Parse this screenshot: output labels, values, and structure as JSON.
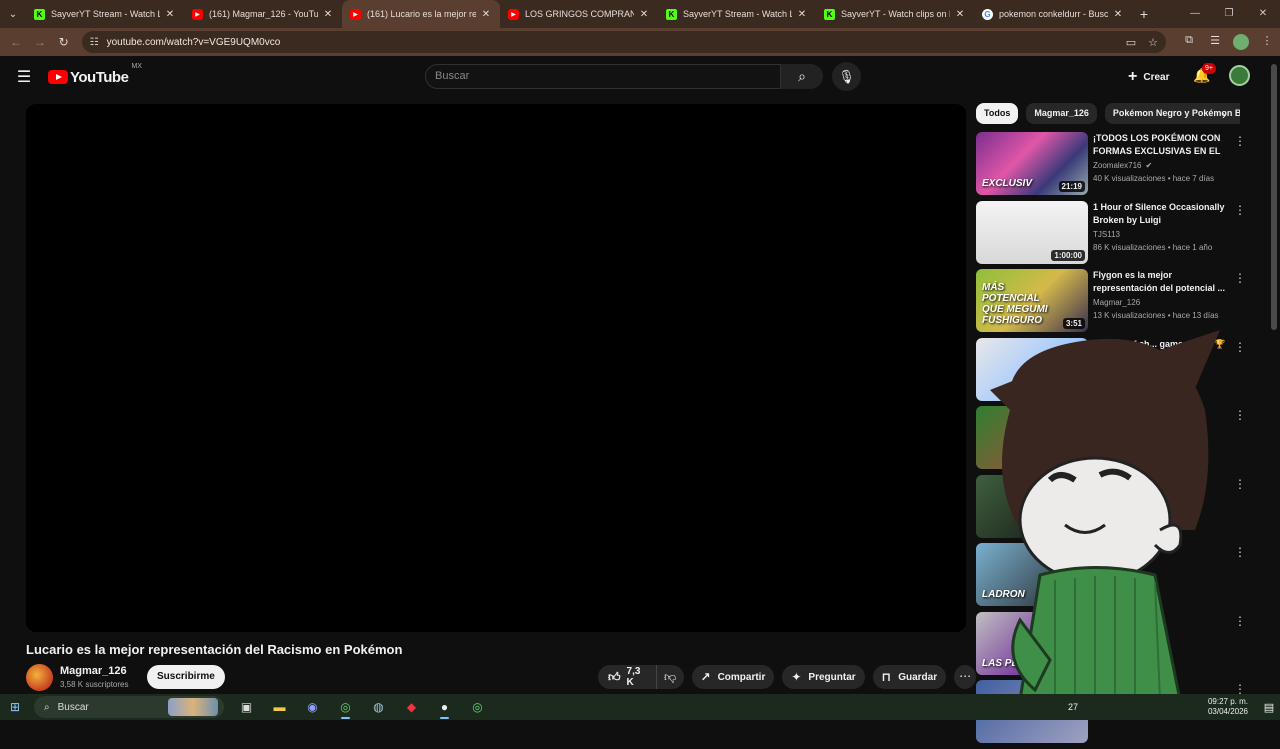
{
  "browser": {
    "tabs": [
      {
        "label": "SayverYT Stream - Watch Live o",
        "favicon": "kick-icon",
        "active": false
      },
      {
        "label": "(161) Magmar_126 - YouTube",
        "favicon": "youtube-icon",
        "active": false
      },
      {
        "label": "(161) Lucario es la mejor repre",
        "favicon": "youtube-icon",
        "active": true
      },
      {
        "label": "LOS GRINGOS COMPRAN BAS",
        "favicon": "youtube-icon",
        "active": false
      },
      {
        "label": "SayverYT Stream - Watch Live o",
        "favicon": "kick-icon",
        "active": false
      },
      {
        "label": "SayverYT - Watch clips on Kick",
        "favicon": "kick-icon",
        "active": false
      },
      {
        "label": "pokemon conkeldurr - Buscar",
        "favicon": "google-icon",
        "active": false
      }
    ],
    "url": "youtube.com/watch?v=VGE9UQM0vco"
  },
  "youtube": {
    "logo_text": "YouTube",
    "country_code": "MX",
    "search_placeholder": "Buscar",
    "create_label": "Crear",
    "notification_count": "9+"
  },
  "video": {
    "title": "Lucario es la mejor representación del Racismo en Pokémon",
    "channel": "Magmar_126",
    "subscribers": "3,58 K suscriptores",
    "subscribe_label": "Suscribirme",
    "likes": "7,3 K",
    "share_label": "Compartir",
    "ask_label": "Preguntar",
    "save_label": "Guardar"
  },
  "chips": [
    "Todos",
    "Magmar_126",
    "Pokémon Negro y Pokémon Blanco"
  ],
  "recommendations": [
    {
      "title": "¡TODOS LOS POKÉMON CON FORMAS EXCLUSIVAS EN EL ...",
      "channel": "Zoomalex716",
      "verified": true,
      "meta": "40 K visualizaciones • hace 7 días",
      "duration": "21:19",
      "thumb_text": "EXCLUSIV"
    },
    {
      "title": "1 Hour of Silence Occasionally Broken by Luigi",
      "channel": "TJS113",
      "verified": false,
      "meta": "86 K visualizaciones • hace 1 año",
      "duration": "1:00:00",
      "thumb_text": ""
    },
    {
      "title": "Flygon es la mejor representación del potencial ...",
      "channel": "Magmar_126",
      "verified": false,
      "meta": "13 K visualizaciones • hace 13 días",
      "duration": "3:51",
      "thumb_text": "MÁS POTENCIAL QUE MEGUMI FUSHIGURO"
    },
    {
      "title": "2 hours of ch... game music 🏆",
      "channel": "alf 🌙",
      "verified": false,
      "meta": "...e visualizaci... 2 años",
      "duration": "",
      "thumb_text": ""
    },
    {
      "title": "...TA más",
      "channel": "",
      "verified": false,
      "meta": "...5 días",
      "duration": "",
      "thumb_text": ""
    },
    {
      "title": "",
      "channel": "",
      "verified": false,
      "meta": "...s",
      "duration": "",
      "thumb_text": ""
    },
    {
      "title": "",
      "channel": "",
      "verified": false,
      "meta": "hace 8 días",
      "duration": "",
      "thumb_text": "LADRON"
    },
    {
      "title": "...X ...NQUICIA",
      "channel": "",
      "verified": false,
      "meta": "3 meses",
      "duration": "",
      "thumb_text": "LAS PEOR"
    },
    {
      "title": "...ADAS en",
      "channel": "",
      "verified": false,
      "meta": "",
      "duration": "",
      "thumb_text": ""
    }
  ],
  "taskbar": {
    "search_label": "Buscar",
    "time": "09:27 p. m.",
    "date": "03/04/2026",
    "temp": "27"
  }
}
